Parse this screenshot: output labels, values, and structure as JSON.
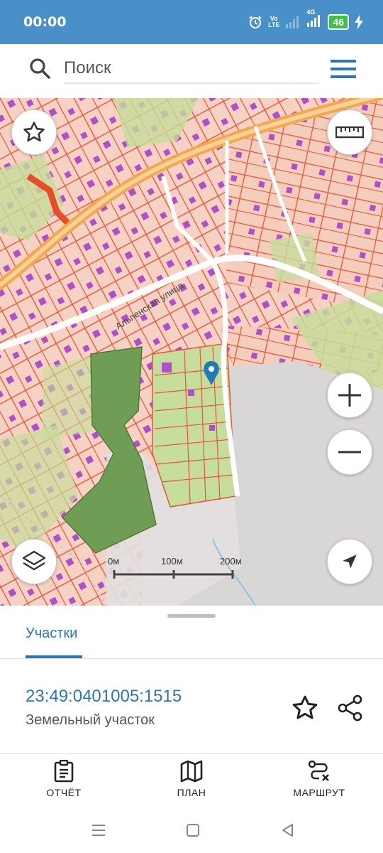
{
  "status_bar": {
    "time": "00:00",
    "network_label_top": "Vo",
    "network_label_bottom": "LTE",
    "network_type": "4G",
    "battery": "46"
  },
  "search": {
    "placeholder": "Поиск"
  },
  "map": {
    "street_label": "Альпенская улица",
    "scale": {
      "tick_0": "0м",
      "tick_100": "100м",
      "tick_200": "200м"
    },
    "colors": {
      "parcel_outline": "#e8553a",
      "parcel_fill": "#f6d2c4",
      "building": "#b14fc9",
      "green": "#c7dd9b",
      "dark_green": "#6f9d55",
      "road": "#f4a84b",
      "pin": "#1f7ab8"
    }
  },
  "sheet": {
    "tab_label": "Участки",
    "cadastral_number": "23:49:0401005:1515",
    "parcel_type": "Земельный участок"
  },
  "bottom_nav": {
    "report": "ОТЧЁТ",
    "plan": "ПЛАН",
    "route": "МАРШРУТ"
  },
  "icons": {
    "search": "search-icon",
    "menu": "menu-icon",
    "favorite": "star-icon",
    "ruler": "ruler-icon",
    "zoom_in": "plus-icon",
    "zoom_out": "minus-icon",
    "layers": "layers-icon",
    "locate": "navigation-arrow-icon",
    "share": "share-icon",
    "report": "clipboard-icon",
    "plan": "map-icon",
    "route": "route-icon"
  }
}
